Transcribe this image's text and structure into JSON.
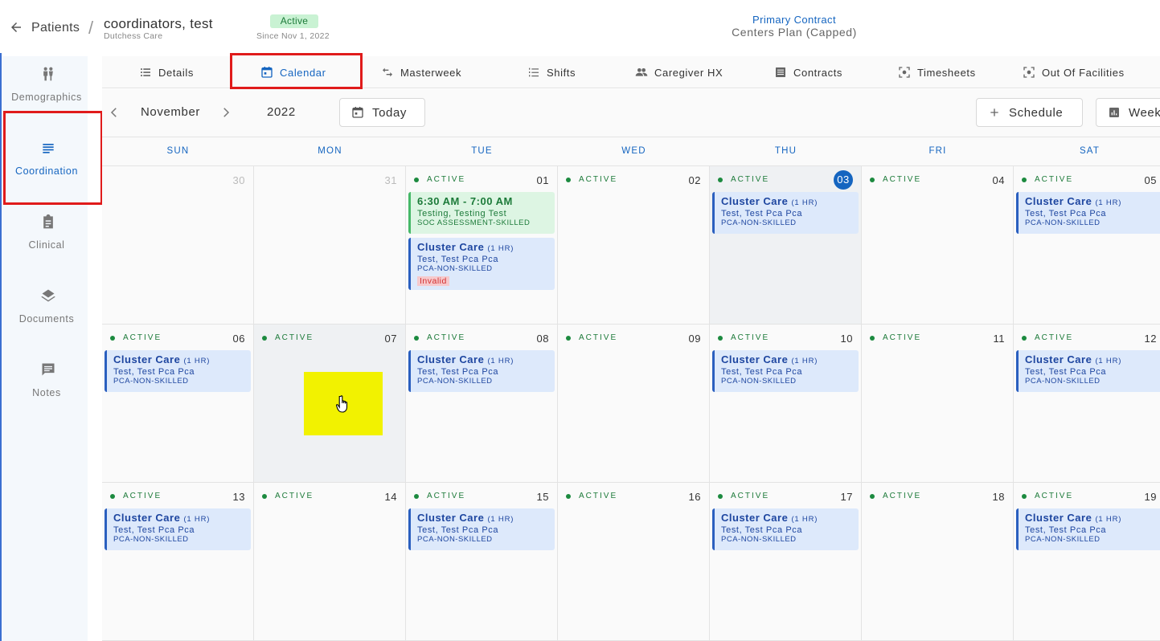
{
  "header": {
    "breadcrumb_root": "Patients",
    "breadcrumb_sep": "/",
    "patient_name": "coordinators, test",
    "agency": "Dutchess Care",
    "status": "Active",
    "since": "Since Nov 1, 2022",
    "contract_label": "Primary Contract",
    "contract_value": "Centers Plan (Capped)"
  },
  "sidebar": {
    "items": [
      {
        "label": "Demographics",
        "icon": "people-icon"
      },
      {
        "label": "Coordination",
        "icon": "list-icon"
      },
      {
        "label": "Clinical",
        "icon": "clipboard-icon"
      },
      {
        "label": "Documents",
        "icon": "layers-icon"
      },
      {
        "label": "Notes",
        "icon": "chat-icon"
      }
    ],
    "active": "Coordination"
  },
  "tabs": [
    {
      "label": "Details",
      "icon": "list-icon"
    },
    {
      "label": "Calendar",
      "icon": "calendar-icon"
    },
    {
      "label": "Masterweek",
      "icon": "swap-icon"
    },
    {
      "label": "Shifts",
      "icon": "list-numbered-icon"
    },
    {
      "label": "Caregiver HX",
      "icon": "group-icon"
    },
    {
      "label": "Contracts",
      "icon": "document-icon"
    },
    {
      "label": "Timesheets",
      "icon": "focus-icon"
    },
    {
      "label": "Out Of Facilities",
      "icon": "focus-icon"
    }
  ],
  "active_tab": "Calendar",
  "toolbar": {
    "month": "November",
    "year": "2022",
    "today_label": "Today",
    "schedule_label": "Schedule",
    "week_label": "Week"
  },
  "calendar": {
    "weekdays": [
      "SUN",
      "MON",
      "TUE",
      "WED",
      "THU",
      "FRI",
      "SAT"
    ],
    "status_label": "ACTIVE",
    "weeks": [
      [
        {
          "day": "30",
          "muted": true,
          "status": false,
          "events": []
        },
        {
          "day": "31",
          "muted": true,
          "status": false,
          "events": []
        },
        {
          "day": "01",
          "status": true,
          "events": [
            {
              "kind": "green",
              "title": "6:30 AM - 7:00 AM",
              "duration": "",
              "name": "Testing, Testing Test",
              "type": "SOC ASSESSMENT-SKILLED"
            },
            {
              "kind": "blue",
              "title": "Cluster Care",
              "duration": "(1 HR)",
              "name": "Test, Test Pca Pca",
              "type": "PCA-NON-SKILLED",
              "flag": "Invalid"
            }
          ]
        },
        {
          "day": "02",
          "status": true,
          "events": []
        },
        {
          "day": "03",
          "today": true,
          "shaded": true,
          "status": true,
          "events": [
            {
              "kind": "blue",
              "title": "Cluster Care",
              "duration": "(1 HR)",
              "name": "Test, Test Pca Pca",
              "type": "PCA-NON-SKILLED"
            }
          ]
        },
        {
          "day": "04",
          "status": true,
          "events": []
        },
        {
          "day": "05",
          "status": true,
          "events": [
            {
              "kind": "blue",
              "title": "Cluster Care",
              "duration": "(1 HR)",
              "name": "Test, Test Pca Pca",
              "type": "PCA-NON-SKILLED"
            }
          ]
        }
      ],
      [
        {
          "day": "06",
          "status": true,
          "events": [
            {
              "kind": "blue",
              "title": "Cluster Care",
              "duration": "(1 HR)",
              "name": "Test, Test Pca Pca",
              "type": "PCA-NON-SKILLED"
            }
          ]
        },
        {
          "day": "07",
          "shaded": true,
          "status": true,
          "events": []
        },
        {
          "day": "08",
          "status": true,
          "events": [
            {
              "kind": "blue",
              "title": "Cluster Care",
              "duration": "(1 HR)",
              "name": "Test, Test Pca Pca",
              "type": "PCA-NON-SKILLED"
            }
          ]
        },
        {
          "day": "09",
          "status": true,
          "events": []
        },
        {
          "day": "10",
          "status": true,
          "events": [
            {
              "kind": "blue",
              "title": "Cluster Care",
              "duration": "(1 HR)",
              "name": "Test, Test Pca Pca",
              "type": "PCA-NON-SKILLED"
            }
          ]
        },
        {
          "day": "11",
          "status": true,
          "events": []
        },
        {
          "day": "12",
          "status": true,
          "events": [
            {
              "kind": "blue",
              "title": "Cluster Care",
              "duration": "(1 HR)",
              "name": "Test, Test Pca Pca",
              "type": "PCA-NON-SKILLED"
            }
          ]
        }
      ],
      [
        {
          "day": "13",
          "status": true,
          "events": [
            {
              "kind": "blue",
              "title": "Cluster Care",
              "duration": "(1 HR)",
              "name": "Test, Test Pca Pca",
              "type": "PCA-NON-SKILLED"
            }
          ]
        },
        {
          "day": "14",
          "status": true,
          "events": []
        },
        {
          "day": "15",
          "status": true,
          "events": [
            {
              "kind": "blue",
              "title": "Cluster Care",
              "duration": "(1 HR)",
              "name": "Test, Test Pca Pca",
              "type": "PCA-NON-SKILLED"
            }
          ]
        },
        {
          "day": "16",
          "status": true,
          "events": []
        },
        {
          "day": "17",
          "status": true,
          "events": [
            {
              "kind": "blue",
              "title": "Cluster Care",
              "duration": "(1 HR)",
              "name": "Test, Test Pca Pca",
              "type": "PCA-NON-SKILLED"
            }
          ]
        },
        {
          "day": "18",
          "status": true,
          "events": []
        },
        {
          "day": "19",
          "status": true,
          "events": [
            {
              "kind": "blue",
              "title": "Cluster Care",
              "duration": "(1 HR)",
              "name": "Test, Test Pca Pca",
              "type": "PCA-NON-SKILLED"
            }
          ]
        }
      ]
    ]
  },
  "colors": {
    "accent": "#1565c0",
    "active_green": "#1c7a39",
    "event_blue_bg": "#dde9fb",
    "event_green_bg": "#ddf5e3",
    "annotation_red": "#e01b1b",
    "highlight_yellow": "#f2f200"
  }
}
